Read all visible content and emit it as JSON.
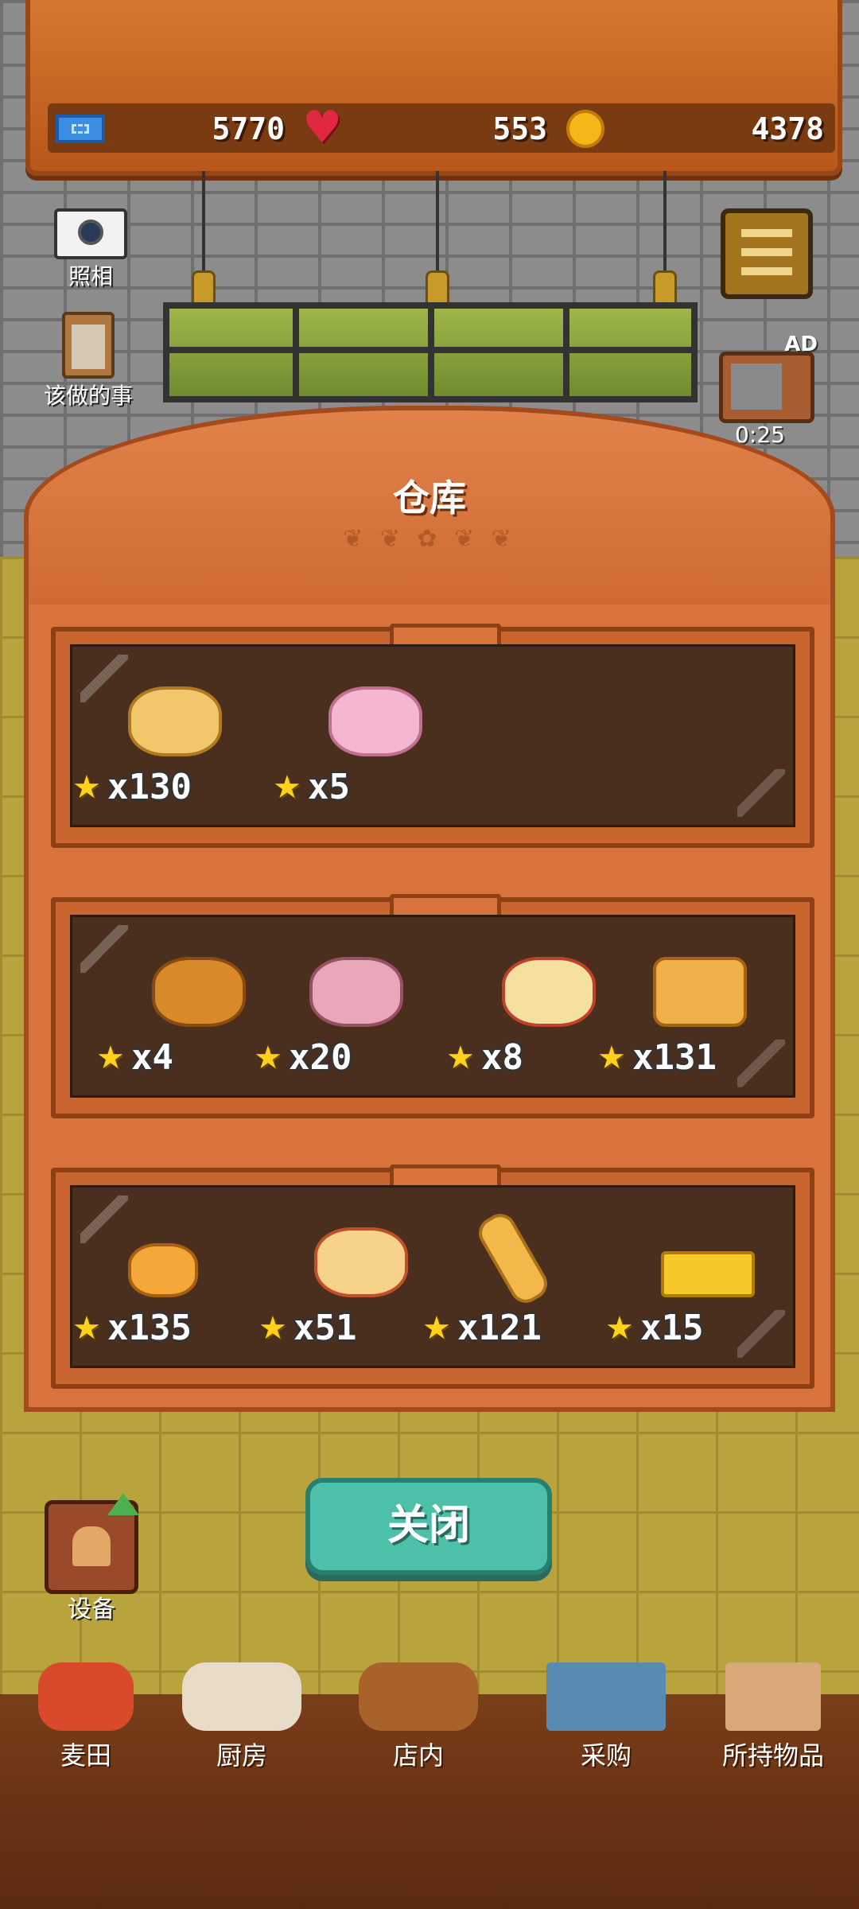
{
  "stats": {
    "tickets": "5770",
    "hearts": "553",
    "coins": "4378"
  },
  "left_buttons": {
    "camera_label": "照相",
    "todo_label": "该做的事"
  },
  "right_buttons": {
    "ad_badge": "AD",
    "ad_timer": "0:25"
  },
  "warehouse": {
    "title": "仓库",
    "shelves": [
      {
        "items": [
          {
            "name": "bagel",
            "count": "x130"
          },
          {
            "name": "pig-bun",
            "count": "x5"
          }
        ]
      },
      {
        "items": [
          {
            "name": "herb-bread",
            "count": "x4"
          },
          {
            "name": "pink-mushroom-bun",
            "count": "x20"
          },
          {
            "name": "chick-bun",
            "count": "x8"
          },
          {
            "name": "loaf",
            "count": "x131"
          }
        ]
      },
      {
        "items": [
          {
            "name": "roll",
            "count": "x135"
          },
          {
            "name": "fruit-tart",
            "count": "x51"
          },
          {
            "name": "baguette",
            "count": "x121"
          },
          {
            "name": "castella",
            "count": "x15"
          }
        ]
      }
    ]
  },
  "close_label": "关闭",
  "equipment_label": "设备",
  "nav": [
    {
      "label": "麦田",
      "icon": "wheat-field-icon"
    },
    {
      "label": "厨房",
      "icon": "kitchen-icon"
    },
    {
      "label": "店内",
      "icon": "shop-icon"
    },
    {
      "label": "采购",
      "icon": "purchase-icon"
    },
    {
      "label": "所持物品",
      "icon": "inventory-icon"
    }
  ],
  "colors": {
    "accent_teal": "#4cc0a8",
    "wood": "#d9733c",
    "star": "#ffd21a"
  }
}
